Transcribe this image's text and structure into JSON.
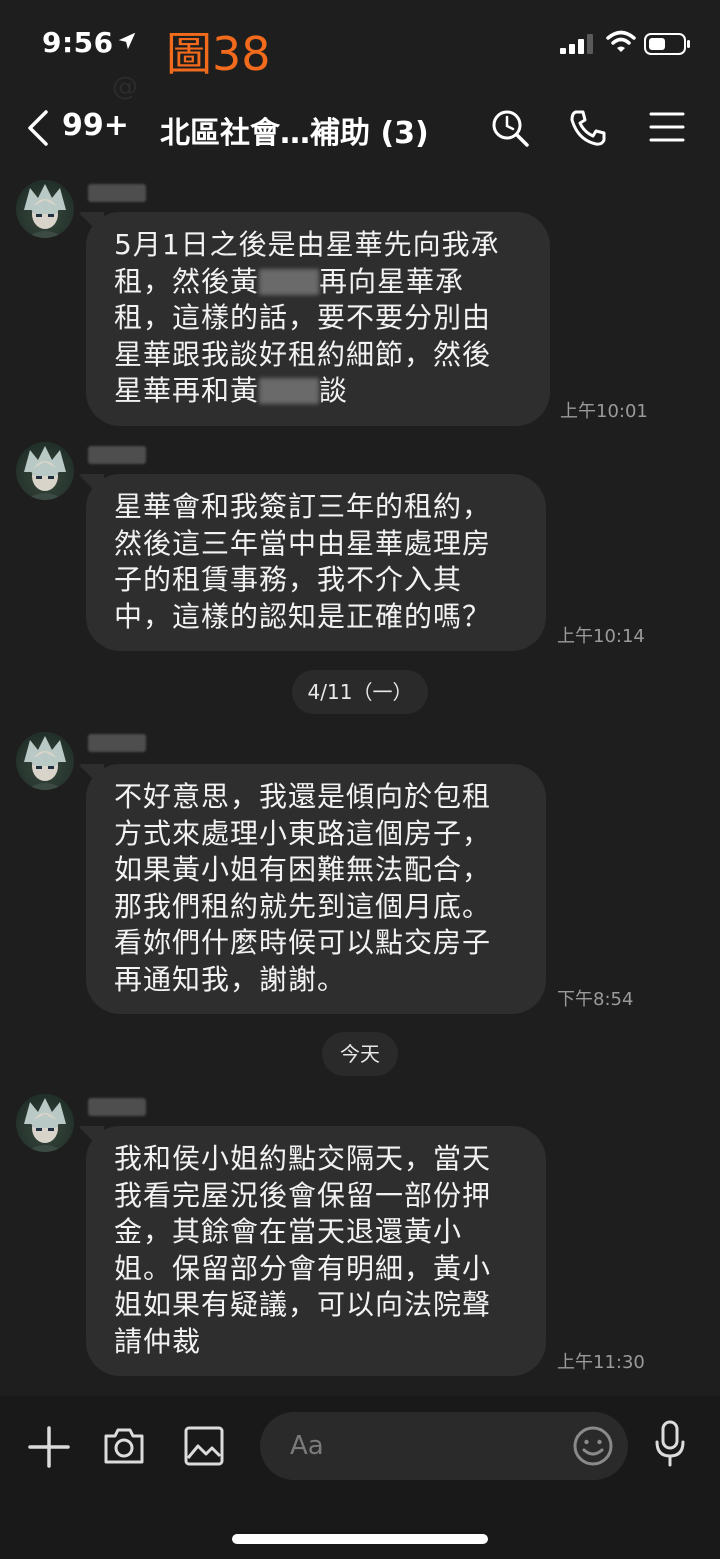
{
  "status_bar": {
    "time": "9:56",
    "figure_label": "圖38"
  },
  "header": {
    "unread_count": "99+",
    "title": "北區社會…補助 (3)"
  },
  "messages": [
    {
      "segments": [
        "5月1日之後是由星華先向我承\n租，然後黃",
        "再向星華承\n租，這樣的話，要不要分別由\n星華跟我談好租約細節，然後\n星華再和黃",
        "談"
      ],
      "time": "上午10:01"
    },
    {
      "text": "星華會和我簽訂三年的租約，\n然後這三年當中由星華處理房\n子的租賃事務，我不介入其\n中，這樣的認知是正確的嗎？",
      "time": "上午10:14"
    },
    {
      "text": "不好意思，我還是傾向於包租\n方式來處理小東路這個房子，\n如果黃小姐有困難無法配合，\n那我們租約就先到這個月底。\n看妳們什麼時候可以點交房子\n再通知我，謝謝。",
      "time": "下午8:54"
    },
    {
      "text": "我和侯小姐約點交隔天，當天\n我看完屋況後會保留一部份押\n金，其餘會在當天退還黃小\n姐。保留部分會有明細，黃小\n姐如果有疑議，可以向法院聲\n請仲裁",
      "time": "上午11:30"
    }
  ],
  "date_separators": [
    "4/11（一）",
    "今天"
  ],
  "input": {
    "placeholder": "Aa"
  },
  "icons": [
    "location-arrow-icon",
    "signal-icon",
    "wifi-icon",
    "battery-icon",
    "back-chevron-icon",
    "search-icon",
    "phone-icon",
    "menu-icon",
    "plus-icon",
    "camera-icon",
    "image-icon",
    "emoji-icon",
    "microphone-icon"
  ],
  "colors": {
    "background": "#1e1e1e",
    "bubble": "#2e2e2e",
    "figure_label": "#f26b1d",
    "timestamp": "#9a9a9a"
  }
}
